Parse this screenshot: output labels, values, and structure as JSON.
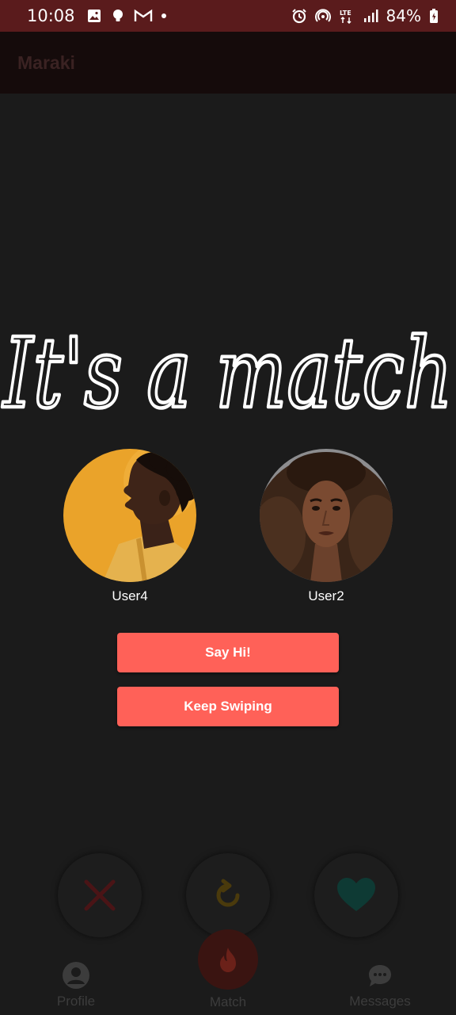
{
  "status_bar": {
    "time": "10:08",
    "battery": "84%",
    "left_icons": [
      "image-icon",
      "bulb-icon",
      "gmail-icon",
      "dot-icon"
    ],
    "right_icons": [
      "alarm-icon",
      "hotspot-icon",
      "lte-icon",
      "signal-icon",
      "battery-icon"
    ]
  },
  "app_bar": {
    "title": "Maraki"
  },
  "match": {
    "headline": "It's a match",
    "users": [
      {
        "name": "User4"
      },
      {
        "name": "User2"
      }
    ],
    "say_hi_label": "Say Hi!",
    "keep_swiping_label": "Keep Swiping"
  },
  "bottom_nav": {
    "items": [
      {
        "label": "Profile",
        "icon": "person-icon"
      },
      {
        "label": "Match",
        "icon": "flame-icon"
      },
      {
        "label": "Messages",
        "icon": "chat-icon"
      }
    ]
  },
  "actions": {
    "icons": [
      "dislike-x-icon",
      "rewind-icon",
      "like-heart-icon"
    ]
  },
  "colors": {
    "status_bar": "#5a1b1c",
    "background": "#1b1b1b",
    "button": "#ff6158"
  }
}
